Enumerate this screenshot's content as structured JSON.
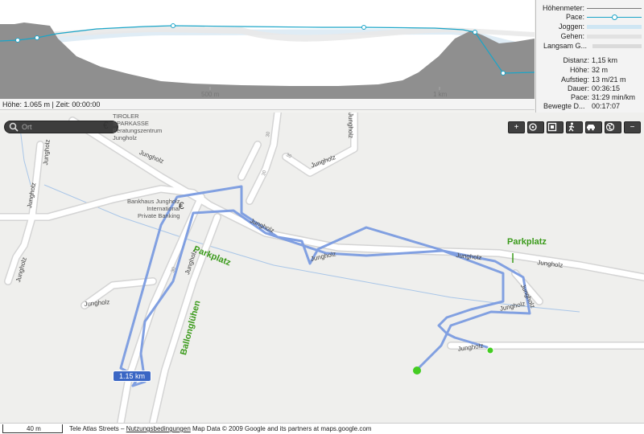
{
  "profile": {
    "ticks": [
      "500 m",
      "1 km"
    ],
    "hover": "Höhe: 1.065 m | Zeit: 00:00:00"
  },
  "legend": {
    "items": [
      {
        "label": "Höhenmeter:",
        "style": "line-grey"
      },
      {
        "label": "Pace:",
        "style": "line-blue"
      },
      {
        "label": "Joggen:",
        "style": "band-lightblue"
      },
      {
        "label": "Gehen:",
        "style": "band-lightgrey"
      },
      {
        "label": "Langsam G...",
        "style": "band-grey"
      }
    ],
    "colors": {
      "pace": "#1aa5c8",
      "terrain": "#8c8c8c",
      "jog": "#cfe6f3",
      "walk": "#e2e2e2"
    }
  },
  "stats": [
    {
      "label": "Distanz:",
      "value": "1,15 km"
    },
    {
      "label": "Höhe:",
      "value": "32 m"
    },
    {
      "label": "Aufstieg:",
      "value": "13 m/21 m"
    },
    {
      "label": "Dauer:",
      "value": "00:36:15"
    },
    {
      "label": "Pace:",
      "value": "31:29 min/km"
    },
    {
      "label": "Bewegte D...",
      "value": "00:17:07"
    }
  ],
  "search": {
    "placeholder": "Ort"
  },
  "toolbar": {
    "buttons": [
      {
        "name": "zoom-in-button",
        "icon": "plus-icon",
        "glyph": "+"
      },
      {
        "name": "center-button",
        "icon": "target-icon"
      },
      {
        "name": "fit-button",
        "icon": "fit-icon"
      },
      {
        "name": "walk-mode-button",
        "icon": "walker-icon"
      },
      {
        "name": "car-mode-button",
        "icon": "car-icon"
      },
      {
        "name": "globe-button",
        "icon": "globe-icon"
      },
      {
        "name": "zoom-out-button",
        "icon": "minus-icon",
        "glyph": "−"
      }
    ]
  },
  "map": {
    "street_labels": [
      "Jungholz",
      "Jungholz",
      "Jungholz",
      "Jungholz",
      "Jungholz",
      "Jungholz",
      "Jungholz",
      "Jungholz",
      "Jungholz",
      "Jungholz",
      "Jungholz",
      "Jungholz",
      "Jungholz",
      "Jungholz",
      "Jungholz"
    ],
    "poi_sparkasse": [
      "TIROLER",
      "SPARKASSE",
      "Beratungszentrum",
      "Jungholz"
    ],
    "poi_bank": [
      "Bankhaus Jungholz",
      "International",
      "Private Banking"
    ],
    "euro_symbol": "€",
    "green_labels": [
      "Parkplatz",
      "Parkplatz",
      "Ballonglühen"
    ],
    "road_numbers": [
      "30",
      "30",
      "30",
      "30"
    ],
    "distance_badge": "1.15 km",
    "colors": {
      "track": "#7a9be0",
      "start": "#44cc22",
      "water": "#a9c6e8"
    }
  },
  "footer": {
    "scale": "40 m",
    "source": "Tele Atlas Streets – ",
    "terms_link": "Nutzungsbedingungen",
    "copyright": " Map Data © 2009 Google and its partners at maps.google.com"
  }
}
